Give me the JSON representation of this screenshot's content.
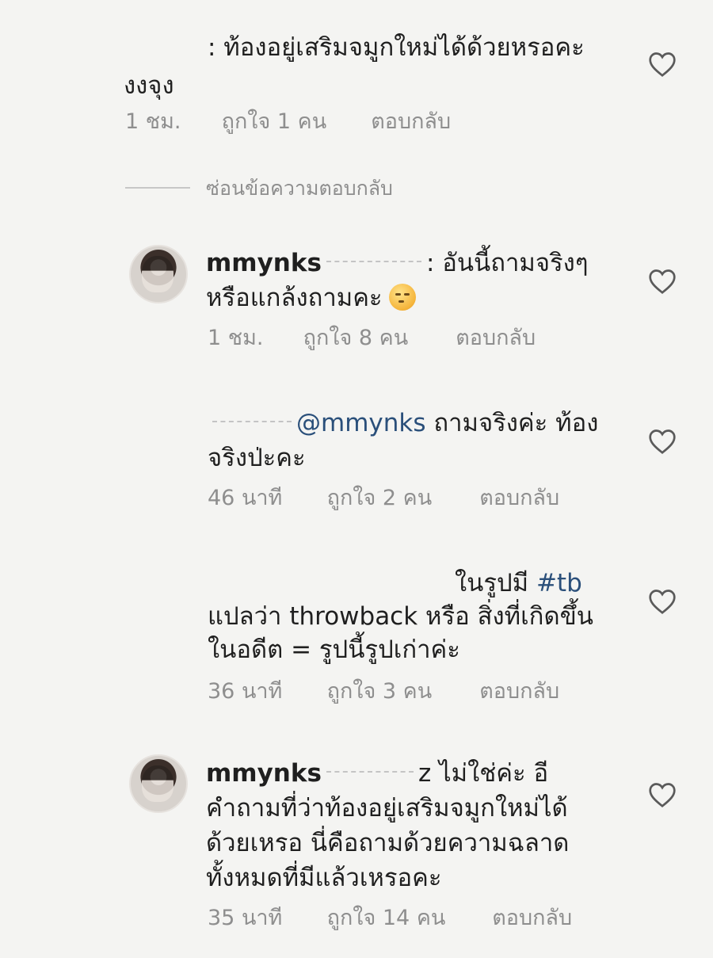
{
  "comments": [
    {
      "lines": [
        ": ท้องอยู่เสริมจมูกใหม่ได้ด้วยหรอคะ",
        "งงจุง"
      ],
      "time": "1 ชม.",
      "likes": "ถูกใจ 1 คน",
      "reply": "ตอบกลับ"
    },
    {
      "username": "mmynks",
      "line1_tail": ": อันนี้ถามจริงๆ",
      "line2": "หรือแกล้งถามคะ",
      "time": "1 ชม.",
      "likes": "ถูกใจ 8 คน",
      "reply": "ตอบกลับ"
    },
    {
      "mention": "@mmynks",
      "line1_tail": "ถามจริงค่ะ ท้อง",
      "line2": "จริงป่ะคะ",
      "time": "46 นาที",
      "likes": "ถูกใจ 2 คน",
      "reply": "ตอบกลับ"
    },
    {
      "line1_prefix": "ในรูปมี",
      "hashtag": "#tb",
      "line2": "แปลว่า throwback หรือ สิ่งที่เกิดขึ้น",
      "line3": "ในอดีต = รูปนี้รูปเก่าค่ะ",
      "time": "36 นาที",
      "likes": "ถูกใจ 3 คน",
      "reply": "ตอบกลับ"
    },
    {
      "username": "mmynks",
      "line1_tail": "z ไม่ใช่ค่ะ อี",
      "line2": "คำถามที่ว่าท้องอยู่เสริมจมูกใหม่ได้",
      "line3": "ด้วยเหรอ นี่คือถามด้วยความฉลาด",
      "line4": "ทั้งหมดที่มีแล้วเหรอคะ",
      "time": "35 นาที",
      "likes": "ถูกใจ 14 คน",
      "reply": "ตอบกลับ"
    }
  ],
  "hide_replies": "ซ่อนข้อความตอบกลับ",
  "colors": {
    "meta": "#8e8e8e",
    "mention": "#2a4f7a",
    "text": "#1f1f1f"
  }
}
